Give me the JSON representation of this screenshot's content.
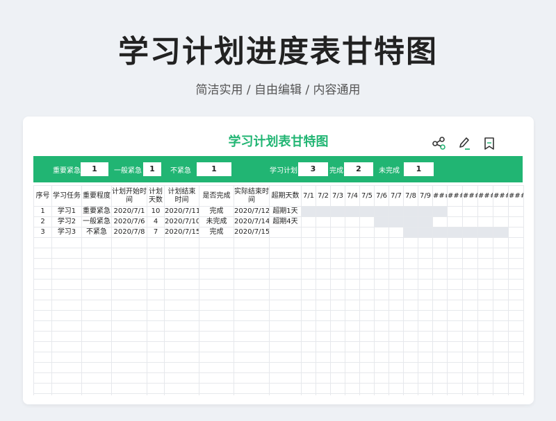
{
  "page": {
    "title": "学习计划进度表甘特图",
    "subtitle": "简洁实用 / 自由编辑 / 内容通用"
  },
  "sheet": {
    "title": "学习计划表甘特图",
    "accent_color": "#21b573",
    "bar_color": "#e4e7ec",
    "icons": [
      "share-icon",
      "edit-icon",
      "bookmark-icon"
    ]
  },
  "summary": [
    {
      "label": "重要紧急",
      "value": "1"
    },
    {
      "label": "一般紧急",
      "value": "1"
    },
    {
      "label": "不紧急",
      "value": "1"
    },
    {
      "label": "学习计划",
      "value": "3"
    },
    {
      "label": "完成",
      "value": "2"
    },
    {
      "label": "未完成",
      "value": "1"
    }
  ],
  "table": {
    "headers": [
      "序号",
      "学习任务",
      "重要程度",
      "计划开始时间",
      "计划天数",
      "计划结束时间",
      "是否完成",
      "实际结束时间",
      "超期天数"
    ],
    "date_headers": [
      "7/1",
      "7/2",
      "7/3",
      "7/4",
      "7/5",
      "7/6",
      "7/7",
      "7/8",
      "7/9",
      "###",
      "###",
      "###",
      "###",
      "###",
      "###"
    ],
    "rows": [
      {
        "cells": [
          "1",
          "学习1",
          "重要紧急",
          "2020/7/1",
          "10",
          "2020/7/11",
          "完成",
          "2020/7/12",
          "超期1天"
        ],
        "bar_start": 0,
        "bar_days": 10
      },
      {
        "cells": [
          "2",
          "学习2",
          "一般紧急",
          "2020/7/6",
          "4",
          "2020/7/10",
          "未完成",
          "2020/7/14",
          "超期4天"
        ],
        "bar_start": 5,
        "bar_days": 4
      },
      {
        "cells": [
          "3",
          "学习3",
          "不紧急",
          "2020/7/8",
          "7",
          "2020/7/15",
          "完成",
          "2020/7/15",
          ""
        ],
        "bar_start": 7,
        "bar_days": 7
      }
    ],
    "empty_rows": 19
  }
}
